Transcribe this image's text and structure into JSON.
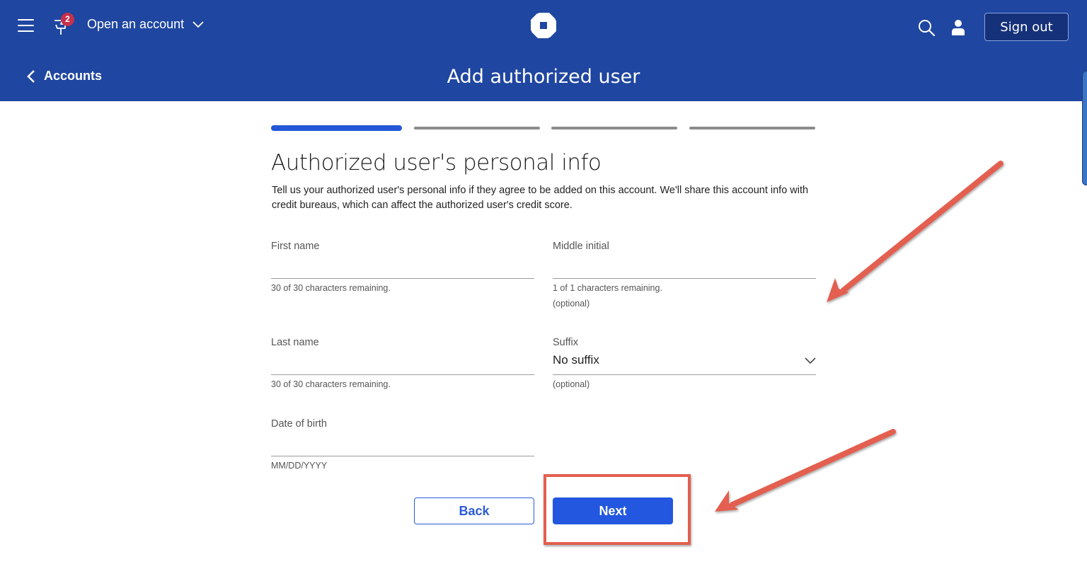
{
  "header": {
    "menu_icon": "hamburger-menu-icon",
    "notification_icon": "flag-icon",
    "notification_count": "2",
    "open_account_label": "Open an account",
    "logo": "chase-octagon-logo",
    "search_icon": "search-icon",
    "profile_icon": "person-icon",
    "sign_out_label": "Sign out",
    "back_label": "Accounts",
    "page_title": "Add authorized user"
  },
  "progress": {
    "total_steps": 4,
    "current_step": 1
  },
  "form": {
    "title": "Authorized user's personal info",
    "description": "Tell us your authorized user's personal info if they agree to be added on this account. We'll share this account info with credit bureaus, which can affect the authorized user's credit score.",
    "fields": {
      "first_name": {
        "label": "First name",
        "value": "",
        "hint": "30 of 30 characters remaining."
      },
      "middle_initial": {
        "label": "Middle initial",
        "value": "",
        "hint": "1 of 1 characters remaining.",
        "optional": "(optional)"
      },
      "last_name": {
        "label": "Last name",
        "value": "",
        "hint": "30 of 30 characters remaining."
      },
      "suffix": {
        "label": "Suffix",
        "value": "No suffix",
        "optional": "(optional)"
      },
      "date_of_birth": {
        "label": "Date of birth",
        "value": "",
        "hint": "MM/DD/YYYY"
      }
    },
    "back_label": "Back",
    "next_label": "Next"
  },
  "colors": {
    "header_bg": "#1f46a0",
    "accent": "#2357e0",
    "annotation": "#e35f50"
  }
}
